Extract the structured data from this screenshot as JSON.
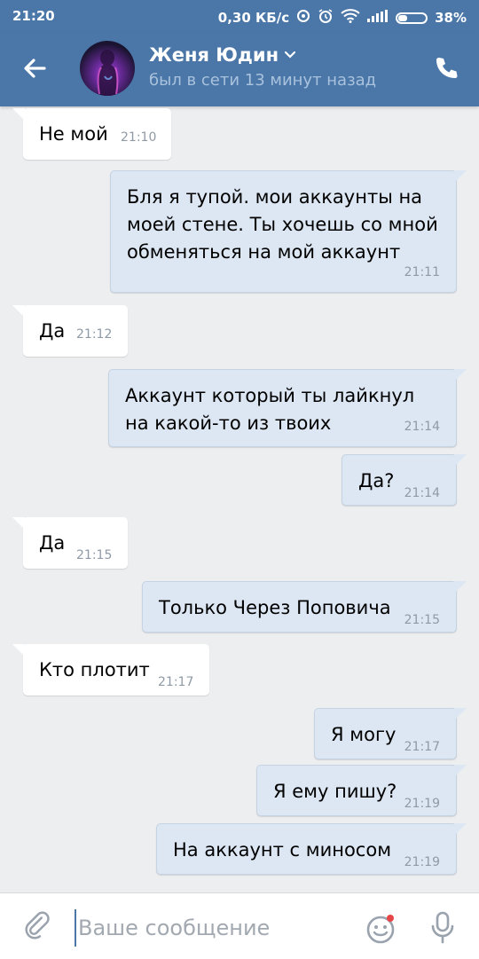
{
  "status_bar": {
    "time": "21:20",
    "network_speed": "0,30 КБ/с",
    "battery": "38%"
  },
  "header": {
    "name": "Женя Юдин",
    "status": "был в сети 13 минут назад"
  },
  "messages": [
    {
      "text": "Не мой",
      "time": "21:10",
      "direction": "in"
    },
    {
      "text": "Бля я тупой. мои аккаунты на моей стене. Ты хочешь со мной обменяться на мой аккаунт",
      "time": "21:11",
      "direction": "out"
    },
    {
      "text": "Да",
      "time": "21:12",
      "direction": "in"
    },
    {
      "text": "Аккаунт который ты лайкнул на какой-то из твоих",
      "time": "21:14",
      "direction": "out"
    },
    {
      "text": "Да?",
      "time": "21:14",
      "direction": "out"
    },
    {
      "text": "Да",
      "time": "21:15",
      "direction": "in"
    },
    {
      "text": "Только Через Поповича",
      "time": "21:15",
      "direction": "out"
    },
    {
      "text": "Кто плотит",
      "time": "21:17",
      "direction": "in"
    },
    {
      "text": "Я могу",
      "time": "21:17",
      "direction": "out"
    },
    {
      "text": "Я ему пишу?",
      "time": "21:19",
      "direction": "out"
    },
    {
      "text": "На аккаунт с миносом",
      "time": "21:19",
      "direction": "out"
    }
  ],
  "composer": {
    "placeholder": "Ваше сообщение"
  },
  "colors": {
    "header": "#4a76a8",
    "incoming_bubble": "#ffffff",
    "outgoing_bubble": "#dce7f3",
    "background": "#edeef0"
  }
}
